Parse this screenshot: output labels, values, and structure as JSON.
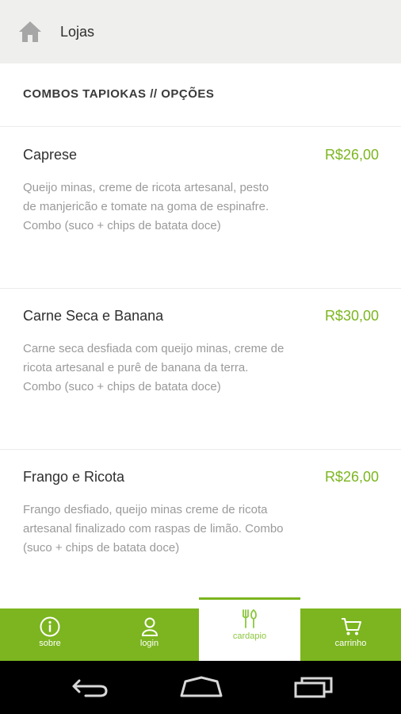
{
  "header": {
    "title": "Lojas",
    "icon": "home-icon"
  },
  "section": {
    "title": "COMBOS TAPIOKAS // OPÇÕES"
  },
  "items": [
    {
      "name": "Caprese",
      "price": "R$26,00",
      "description": "Queijo minas, creme de ricota artesanal, pesto de manjericão e tomate na goma de espinafre. Combo (suco + chips de batata doce)"
    },
    {
      "name": "Carne Seca e Banana",
      "price": "R$30,00",
      "description": "Carne seca desfiada com queijo minas, creme de ricota artesanal e purê de banana da terra. Combo (suco + chips de batata doce)"
    },
    {
      "name": "Frango e Ricota",
      "price": "R$26,00",
      "description": "Frango desfiado, queijo minas creme de ricota artesanal finalizado com raspas de limão. Combo (suco + chips de batata doce)"
    }
  ],
  "tabs": [
    {
      "label": "sobre",
      "icon": "info-icon"
    },
    {
      "label": "login",
      "icon": "user-icon"
    },
    {
      "label": "cardapio",
      "icon": "utensils-icon",
      "active": true
    },
    {
      "label": "carrinho",
      "icon": "cart-icon"
    }
  ],
  "colors": {
    "accent": "#7cb51f",
    "header_bg": "#efefed",
    "nav_bg": "#000000"
  }
}
